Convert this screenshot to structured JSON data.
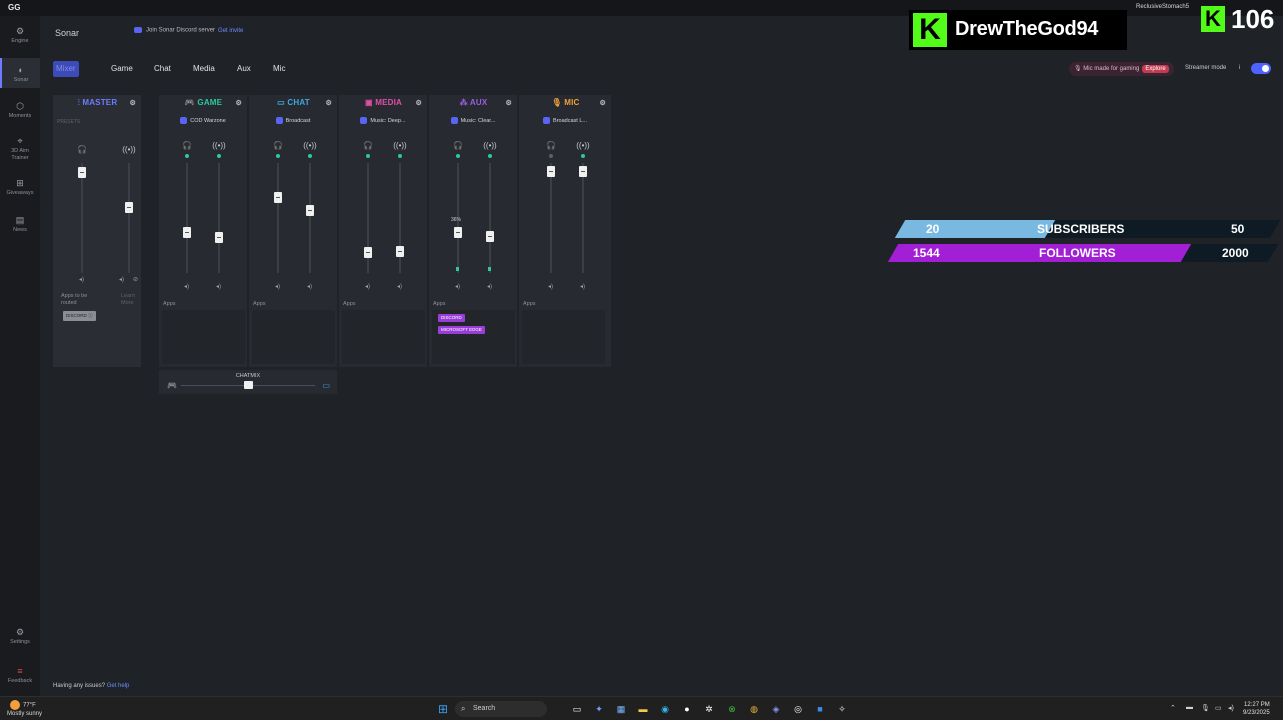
{
  "window": {
    "logo": "GG",
    "user": "ReclusiveStomach5"
  },
  "sidebar": {
    "items": [
      {
        "label": "Engine",
        "icon": "gear-icon"
      },
      {
        "label": "Sonar",
        "icon": "sonar-icon"
      },
      {
        "label": "Moments",
        "icon": "moments-icon"
      },
      {
        "label": "3D Aim Trainer",
        "icon": "aim-icon"
      },
      {
        "label": "Giveaways",
        "icon": "gift-icon"
      },
      {
        "label": "News",
        "icon": "news-icon"
      },
      {
        "label": "Settings",
        "icon": "settings-icon"
      },
      {
        "label": "Feedback",
        "icon": "feedback-icon"
      }
    ]
  },
  "header": {
    "title": "Sonar",
    "discord_text": "Join Sonar Discord server",
    "discord_link": "Get invite"
  },
  "tabs": [
    "Mixer",
    "Game",
    "Chat",
    "Media",
    "Aux",
    "Mic"
  ],
  "right_controls": {
    "mic_made_text": "Mic made for gaming",
    "explore": "Explore",
    "streamer_mode": "Streamer mode",
    "streamer_info": "i"
  },
  "mixer": {
    "master": {
      "label": "MASTER",
      "presets": "PRESETS",
      "apps_hint": "Apps to be routed",
      "learn_more": "Learn More",
      "chip": "DISCORD",
      "color": "#6c7cff"
    },
    "channels": [
      {
        "label": "GAME",
        "device": "COD Warzone",
        "color": "#2bc8a5",
        "apps_label": "Apps",
        "chips": []
      },
      {
        "label": "CHAT",
        "device": "Broadcast",
        "color": "#3fa9e0",
        "apps_label": "Apps",
        "chips": []
      },
      {
        "label": "MEDIA",
        "device": "Music: Deep...",
        "color": "#e14fa8",
        "apps_label": "Apps",
        "chips": []
      },
      {
        "label": "AUX",
        "device": "Music: Clear...",
        "color": "#9a5ee6",
        "apps_label": "Apps",
        "tooltip": "36%",
        "chips": [
          "DISCORD",
          "MICROSOFT EDGE"
        ]
      },
      {
        "label": "MIC",
        "device": "Broadcast L...",
        "color": "#f0a13a",
        "apps_label": "Apps",
        "chips": []
      }
    ]
  },
  "chatmix": {
    "label": "CHATMIX"
  },
  "footer": {
    "help_text": "Having any issues?",
    "help_link": "Get help"
  },
  "overlay": {
    "name": "DrewTheGod94",
    "count": "106",
    "subs": {
      "current": "20",
      "label": "SUBSCRIBERS",
      "goal": "50",
      "progress": 0.4,
      "color": "#79b8e0"
    },
    "followers": {
      "current": "1544",
      "label": "FOLLOWERS",
      "goal": "2000",
      "progress": 0.772,
      "color": "#a21fd6"
    }
  },
  "taskbar": {
    "weather_temp": "77°F",
    "weather_desc": "Mostly sunny",
    "search": "Search",
    "time": "12:27 PM",
    "date": "9/23/2025"
  }
}
